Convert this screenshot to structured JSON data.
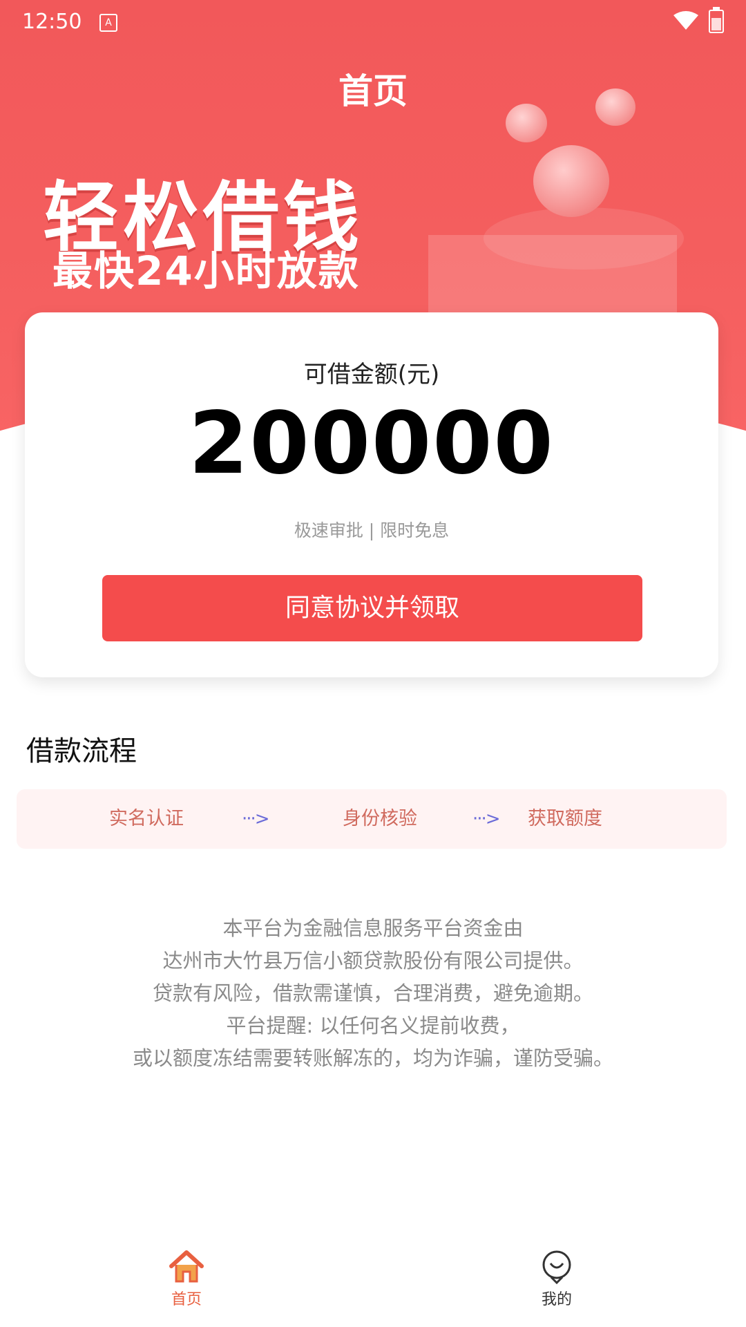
{
  "status_bar": {
    "time": "12:50",
    "app_badge": "A"
  },
  "header": {
    "title": "首页"
  },
  "banner": {
    "slogan": "轻松借钱",
    "subslogan": "最快24小时放款"
  },
  "card": {
    "label": "可借金额(元)",
    "amount": "200000",
    "tagline": "极速审批 | 限时免息",
    "button_label": "同意协议并领取"
  },
  "process": {
    "title": "借款流程",
    "steps": [
      "实名认证",
      "身份核验",
      "获取额度"
    ],
    "arrow": "···>"
  },
  "disclaimer": {
    "lines": [
      "本平台为金融信息服务平台资金由",
      "达州市大竹县万信小额贷款股份有限公司提供。",
      "贷款有风险，借款需谨慎，合理消费，避免逾期。",
      "平台提醒: 以任何名义提前收费，",
      "或以额度冻结需要转账解冻的，均为诈骗，谨防受骗。"
    ]
  },
  "tabbar": {
    "items": [
      {
        "label": "首页",
        "icon": "home-icon",
        "active": true
      },
      {
        "label": "我的",
        "icon": "profile-icon",
        "active": false
      }
    ]
  },
  "colors": {
    "primary": "#f44c4c",
    "hero": "#f45e5e",
    "step_text": "#d06a5e",
    "tab_active": "#e86040"
  }
}
